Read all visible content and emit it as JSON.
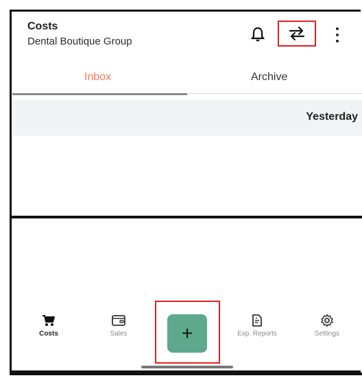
{
  "header": {
    "title": "Costs",
    "subtitle": "Dental Boutique Group",
    "icons": [
      "bell-icon",
      "swap-icon",
      "more-vertical-icon"
    ]
  },
  "tabs": [
    {
      "label": "Inbox",
      "active": true
    },
    {
      "label": "Archive",
      "active": false
    }
  ],
  "list": {
    "date_group": "Yesterday"
  },
  "bottom_nav": [
    {
      "label": "Costs",
      "icon": "cart-icon",
      "active": true
    },
    {
      "label": "Sales",
      "icon": "wallet-icon",
      "active": false
    },
    {
      "label": "Exp. Reports",
      "icon": "report-icon",
      "active": false
    },
    {
      "label": "Settings",
      "icon": "gear-icon",
      "active": false
    }
  ],
  "fab": {
    "label": "+"
  },
  "colors": {
    "accent": "#f07b55",
    "fab": "#5ea88d",
    "highlight": "#e02020"
  }
}
